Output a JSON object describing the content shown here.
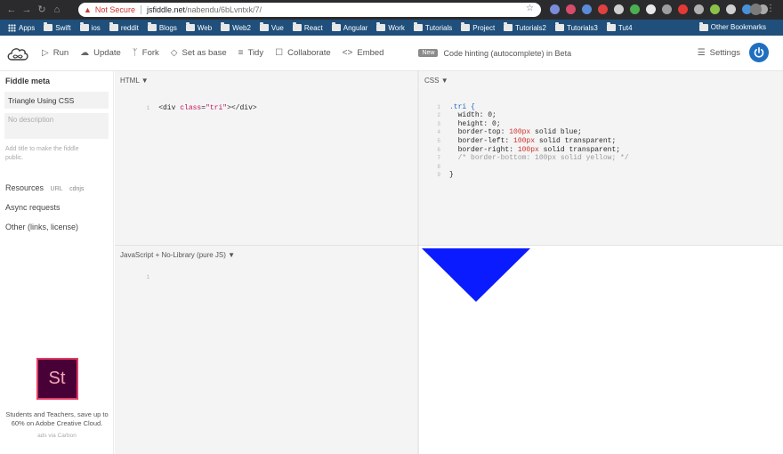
{
  "browser": {
    "not_secure": "Not Secure",
    "url_host": "jsfiddle.net",
    "url_path": "/nabendu/6bLvntxk/7/"
  },
  "bookmarks": {
    "apps": "Apps",
    "folders": [
      "Swift",
      "ios",
      "reddit",
      "Blogs",
      "Web",
      "Web2",
      "Vue",
      "React",
      "Angular",
      "Work",
      "Tutorials",
      "Project",
      "Tutorials2",
      "Tutorials3",
      "Tut4"
    ],
    "other": "Other Bookmarks"
  },
  "toolbar": {
    "run": "Run",
    "update": "Update",
    "fork": "Fork",
    "set_as_base": "Set as base",
    "tidy": "Tidy",
    "collaborate": "Collaborate",
    "embed": "Embed",
    "new_badge": "New",
    "hint": "Code hinting (autocomplete) in Beta",
    "settings": "Settings"
  },
  "sidebar": {
    "title": "Fiddle meta",
    "fiddle_title": "Triangle Using CSS",
    "description_placeholder": "No description",
    "help": "Add title to make the fiddle public.",
    "resources": "Resources",
    "url": "URL",
    "cdnjs": "cdnjs",
    "async": "Async requests",
    "other": "Other (links, license)"
  },
  "ad": {
    "logo_text": "St",
    "text": "Students and Teachers, save up to 60% on Adobe Creative Cloud.",
    "via": "ads via Carbon"
  },
  "panels": {
    "html_title": "HTML",
    "css_title": "CSS",
    "js_title": "JavaScript + No-Library (pure JS)"
  },
  "html_code": {
    "line": "1",
    "open": "<div ",
    "attr": "class",
    "eq": "=",
    "val": "\"tri\"",
    "close": "></div>"
  },
  "css_code": {
    "selector": ".tri {",
    "width": "width: 0;",
    "height": "height: 0;",
    "bt_prop": "border-top: ",
    "bt_num": "100px",
    "bt_rest": " solid blue;",
    "bl_prop": "border-left: ",
    "bl_num": "100px",
    "bl_rest": " solid transparent;",
    "br_prop": "border-right: ",
    "br_num": "100px",
    "br_rest": " solid transparent;",
    "comment": "/* border-bottom: 100px solid yellow; */",
    "close": "}",
    "line_numbers": [
      "1",
      "2",
      "3",
      "4",
      "5",
      "6",
      "7",
      "8",
      "9"
    ]
  },
  "js_code": {
    "line": "1"
  },
  "colors": {
    "triangle": "#0a1bff",
    "brand": "#1f6fc1"
  }
}
